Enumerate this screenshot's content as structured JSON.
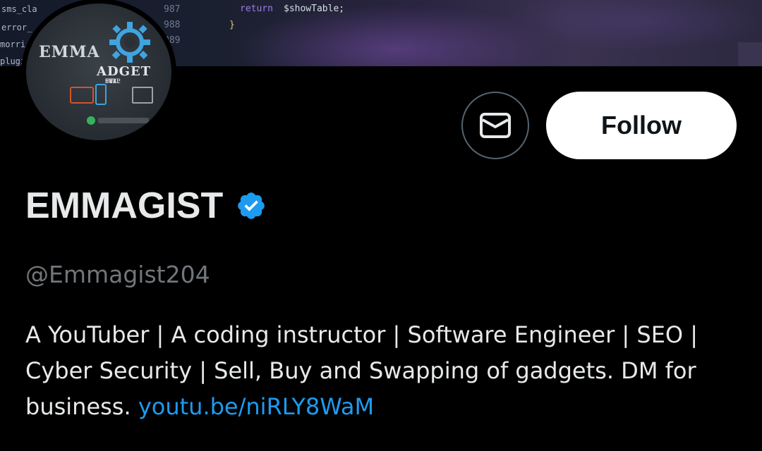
{
  "banner": {
    "code_return_keyword": "return",
    "code_return_var": "$showTable;",
    "code_brace": "}",
    "gutter_numbers": [
      "987",
      "988",
      "989"
    ],
    "files": [
      "sms_cla",
      "error_",
      "morri",
      "plugi"
    ]
  },
  "avatar": {
    "logo_main": "EMMA",
    "logo_secondary": "ADGET",
    "logo_lines": [
      "BUY",
      "SELL",
      "FIX",
      "SWAP"
    ]
  },
  "profile": {
    "name": "EMMAGIST",
    "handle": "@Emmagist204",
    "bio_text": "A YouTuber | A coding instructor | Software Engineer | SEO | Cyber Security | Sell, Buy and Swapping of gadgets. DM for business. ",
    "bio_link": "youtu.be/niRLY8WaM"
  },
  "actions": {
    "follow_label": "Follow"
  },
  "icons": {
    "message": "envelope-icon",
    "verified": "verified-badge-icon"
  },
  "colors": {
    "background": "#000000",
    "text": "#e7e9ea",
    "muted": "#71767b",
    "link": "#1d9bf0",
    "follow_bg": "#ffffff",
    "verified": "#1d9bf0"
  }
}
